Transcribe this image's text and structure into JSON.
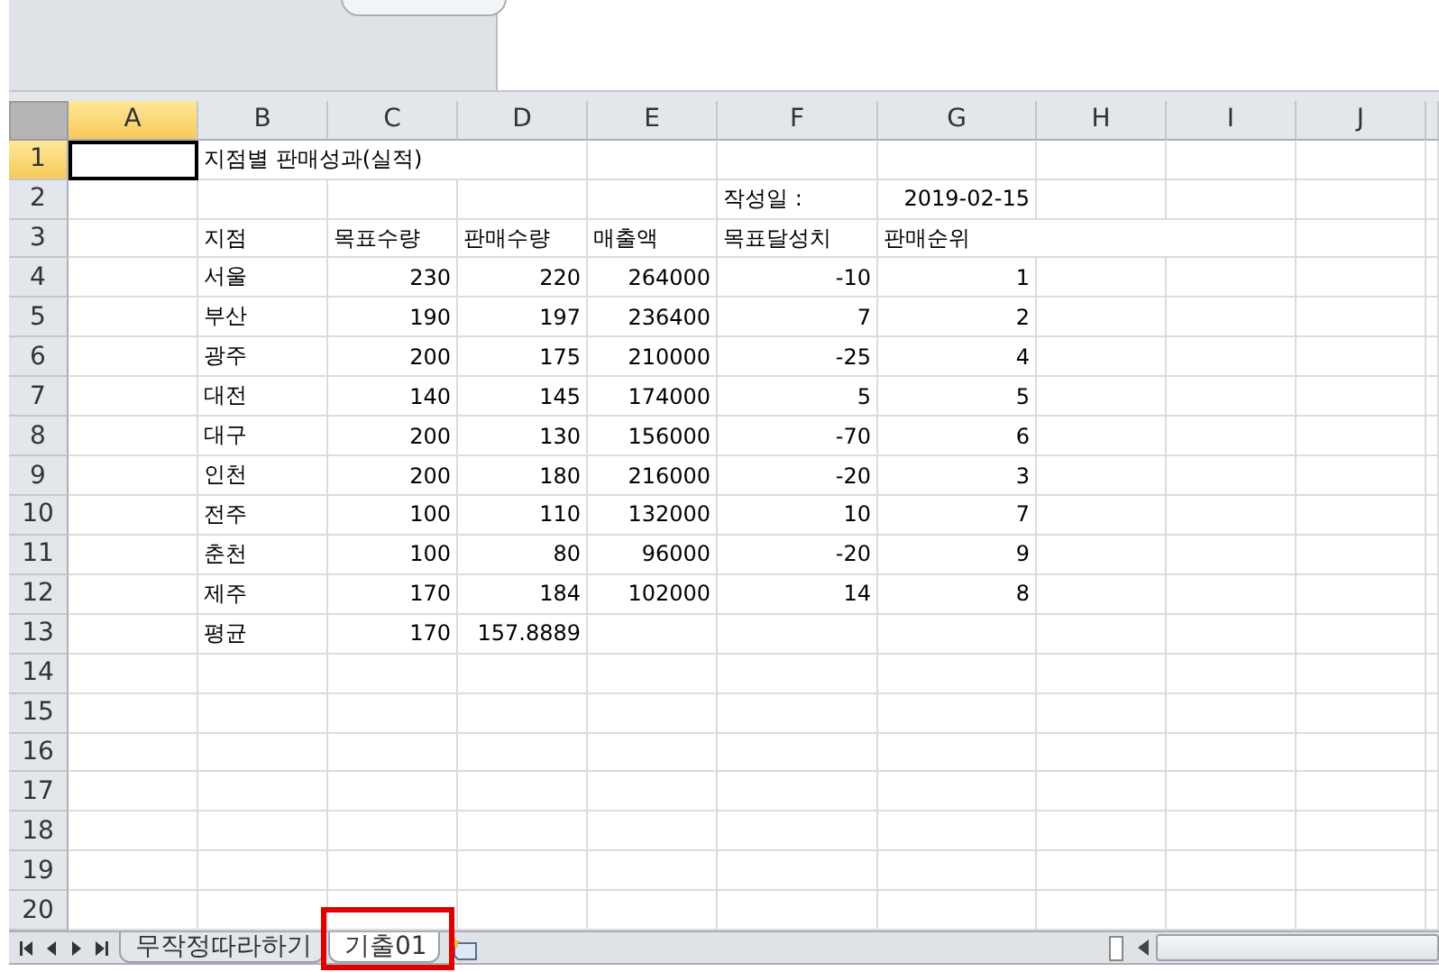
{
  "columns": [
    {
      "label": "A",
      "selected": true
    },
    {
      "label": "B",
      "selected": false
    },
    {
      "label": "C",
      "selected": false
    },
    {
      "label": "D",
      "selected": false
    },
    {
      "label": "E",
      "selected": false
    },
    {
      "label": "F",
      "selected": false
    },
    {
      "label": "G",
      "selected": false
    },
    {
      "label": "H",
      "selected": false
    },
    {
      "label": "I",
      "selected": false
    },
    {
      "label": "J",
      "selected": false
    }
  ],
  "rows": [
    {
      "label": "1",
      "selected": true,
      "cells": [
        {
          "kind": "blank"
        },
        {
          "kind": "text",
          "value": "지점별 판매성과(실적)"
        }
      ]
    },
    {
      "label": "2",
      "selected": false,
      "cells": [
        {
          "kind": "blank"
        },
        {
          "kind": "blank"
        },
        {
          "kind": "blank"
        },
        {
          "kind": "blank"
        },
        {
          "kind": "blank"
        },
        {
          "kind": "text",
          "value": "작성일 :"
        },
        {
          "kind": "number",
          "value": "2019-02-15"
        }
      ]
    },
    {
      "label": "3",
      "selected": false,
      "cells": [
        {
          "kind": "blank"
        },
        {
          "kind": "text",
          "value": "지점"
        },
        {
          "kind": "text",
          "value": "목표수량"
        },
        {
          "kind": "text",
          "value": "판매수량"
        },
        {
          "kind": "text",
          "value": "매출액"
        },
        {
          "kind": "text",
          "value": "목표달성치"
        },
        {
          "kind": "text",
          "value": "판매순위"
        }
      ]
    },
    {
      "label": "4",
      "selected": false,
      "cells": [
        {
          "kind": "blank"
        },
        {
          "kind": "text",
          "value": "서울"
        },
        {
          "kind": "number",
          "value": "230"
        },
        {
          "kind": "number",
          "value": "220"
        },
        {
          "kind": "number",
          "value": "264000"
        },
        {
          "kind": "number",
          "value": "-10"
        },
        {
          "kind": "number",
          "value": "1"
        }
      ]
    },
    {
      "label": "5",
      "selected": false,
      "cells": [
        {
          "kind": "blank"
        },
        {
          "kind": "text",
          "value": "부산"
        },
        {
          "kind": "number",
          "value": "190"
        },
        {
          "kind": "number",
          "value": "197"
        },
        {
          "kind": "number",
          "value": "236400"
        },
        {
          "kind": "number",
          "value": "7"
        },
        {
          "kind": "number",
          "value": "2"
        }
      ]
    },
    {
      "label": "6",
      "selected": false,
      "cells": [
        {
          "kind": "blank"
        },
        {
          "kind": "text",
          "value": "광주"
        },
        {
          "kind": "number",
          "value": "200"
        },
        {
          "kind": "number",
          "value": "175"
        },
        {
          "kind": "number",
          "value": "210000"
        },
        {
          "kind": "number",
          "value": "-25"
        },
        {
          "kind": "number",
          "value": "4"
        }
      ]
    },
    {
      "label": "7",
      "selected": false,
      "cells": [
        {
          "kind": "blank"
        },
        {
          "kind": "text",
          "value": "대전"
        },
        {
          "kind": "number",
          "value": "140"
        },
        {
          "kind": "number",
          "value": "145"
        },
        {
          "kind": "number",
          "value": "174000"
        },
        {
          "kind": "number",
          "value": "5"
        },
        {
          "kind": "number",
          "value": "5"
        }
      ]
    },
    {
      "label": "8",
      "selected": false,
      "cells": [
        {
          "kind": "blank"
        },
        {
          "kind": "text",
          "value": "대구"
        },
        {
          "kind": "number",
          "value": "200"
        },
        {
          "kind": "number",
          "value": "130"
        },
        {
          "kind": "number",
          "value": "156000"
        },
        {
          "kind": "number",
          "value": "-70"
        },
        {
          "kind": "number",
          "value": "6"
        }
      ]
    },
    {
      "label": "9",
      "selected": false,
      "cells": [
        {
          "kind": "blank"
        },
        {
          "kind": "text",
          "value": "인천"
        },
        {
          "kind": "number",
          "value": "200"
        },
        {
          "kind": "number",
          "value": "180"
        },
        {
          "kind": "number",
          "value": "216000"
        },
        {
          "kind": "number",
          "value": "-20"
        },
        {
          "kind": "number",
          "value": "3"
        }
      ]
    },
    {
      "label": "10",
      "selected": false,
      "cells": [
        {
          "kind": "blank"
        },
        {
          "kind": "text",
          "value": "전주"
        },
        {
          "kind": "number",
          "value": "100"
        },
        {
          "kind": "number",
          "value": "110"
        },
        {
          "kind": "number",
          "value": "132000"
        },
        {
          "kind": "number",
          "value": "10"
        },
        {
          "kind": "number",
          "value": "7"
        }
      ]
    },
    {
      "label": "11",
      "selected": false,
      "cells": [
        {
          "kind": "blank"
        },
        {
          "kind": "text",
          "value": "춘천"
        },
        {
          "kind": "number",
          "value": "100"
        },
        {
          "kind": "number",
          "value": "80"
        },
        {
          "kind": "number",
          "value": "96000"
        },
        {
          "kind": "number",
          "value": "-20"
        },
        {
          "kind": "number",
          "value": "9"
        }
      ]
    },
    {
      "label": "12",
      "selected": false,
      "cells": [
        {
          "kind": "blank"
        },
        {
          "kind": "text",
          "value": "제주"
        },
        {
          "kind": "number",
          "value": "170"
        },
        {
          "kind": "number",
          "value": "184"
        },
        {
          "kind": "number",
          "value": "102000"
        },
        {
          "kind": "number",
          "value": "14"
        },
        {
          "kind": "number",
          "value": "8"
        }
      ]
    },
    {
      "label": "13",
      "selected": false,
      "cells": [
        {
          "kind": "blank"
        },
        {
          "kind": "text",
          "value": "평균"
        },
        {
          "kind": "number",
          "value": "170"
        },
        {
          "kind": "number",
          "value": "157.8889"
        }
      ]
    },
    {
      "label": "14",
      "selected": false,
      "cells": []
    },
    {
      "label": "15",
      "selected": false,
      "cells": []
    },
    {
      "label": "16",
      "selected": false,
      "cells": []
    },
    {
      "label": "17",
      "selected": false,
      "cells": []
    },
    {
      "label": "18",
      "selected": false,
      "cells": []
    },
    {
      "label": "19",
      "selected": false,
      "cells": []
    },
    {
      "label": "20",
      "selected": false,
      "cells": []
    }
  ],
  "sheets": [
    {
      "label": "무작정따라하기",
      "selected": false,
      "highlighted": false
    },
    {
      "label": "기출01",
      "selected": true,
      "highlighted": true
    }
  ]
}
